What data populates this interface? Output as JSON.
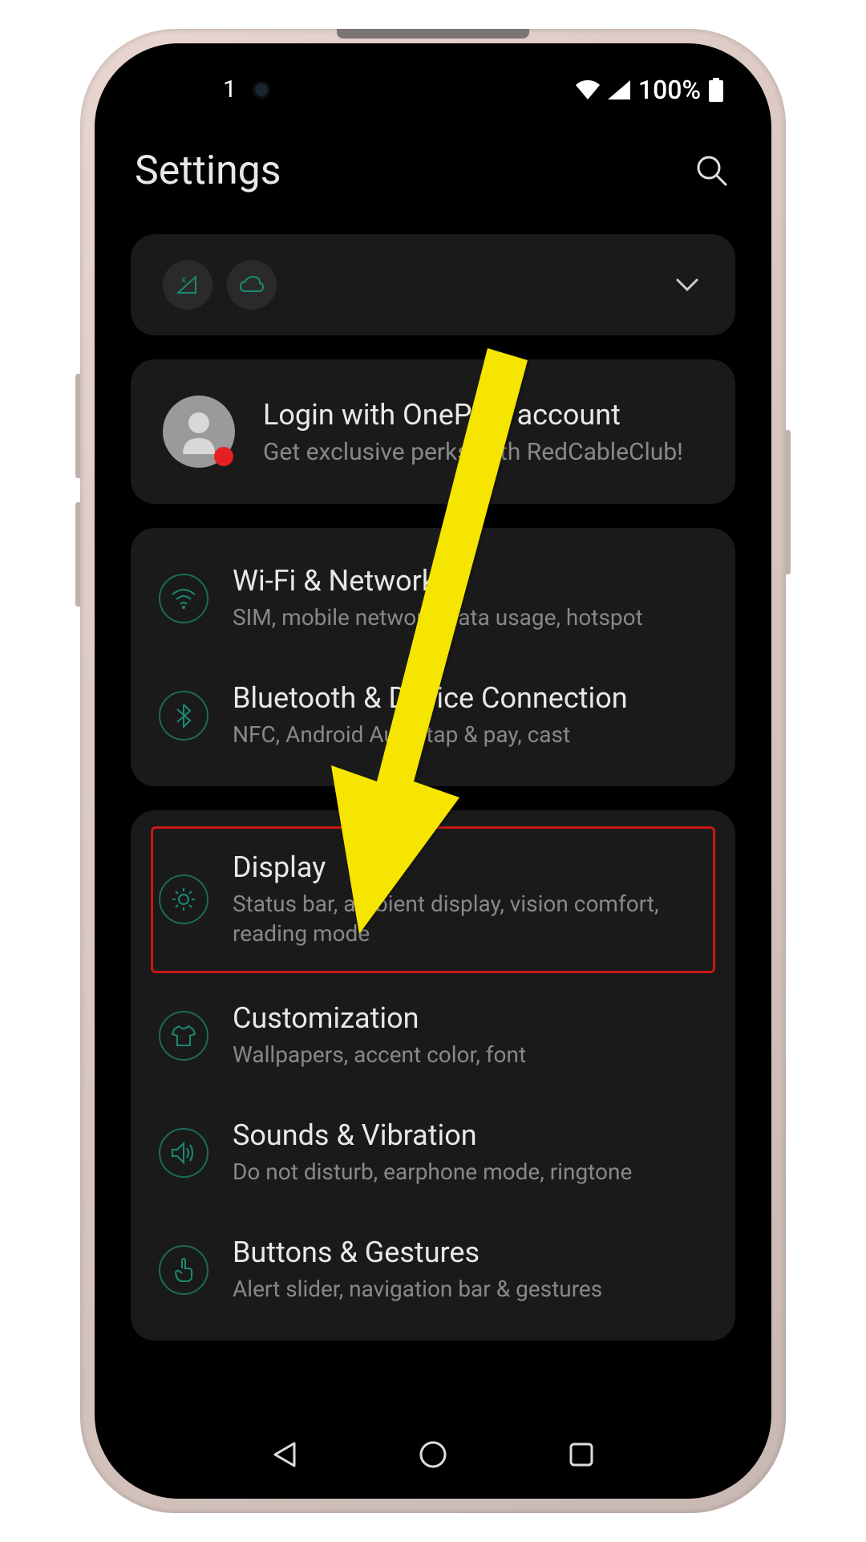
{
  "status_bar": {
    "notification_count": "1",
    "battery_text": "100%"
  },
  "header": {
    "title": "Settings"
  },
  "account": {
    "title": "Login with OnePlus account",
    "subtitle": "Get exclusive perks with RedCableClub!"
  },
  "group1": {
    "wifi": {
      "title": "Wi-Fi & Network",
      "subtitle": "SIM, mobile network, data usage, hotspot"
    },
    "bluetooth": {
      "title": "Bluetooth & Device Connection",
      "subtitle": "NFC, Android Auto, tap & pay, cast"
    }
  },
  "group2": {
    "display": {
      "title": "Display",
      "subtitle": "Status bar, ambient display, vision comfort, reading mode"
    },
    "customization": {
      "title": "Customization",
      "subtitle": "Wallpapers, accent color, font"
    },
    "sounds": {
      "title": "Sounds & Vibration",
      "subtitle": "Do not disturb, earphone mode, ringtone"
    },
    "buttons": {
      "title": "Buttons & Gestures",
      "subtitle": "Alert slider, navigation bar & gestures"
    }
  }
}
